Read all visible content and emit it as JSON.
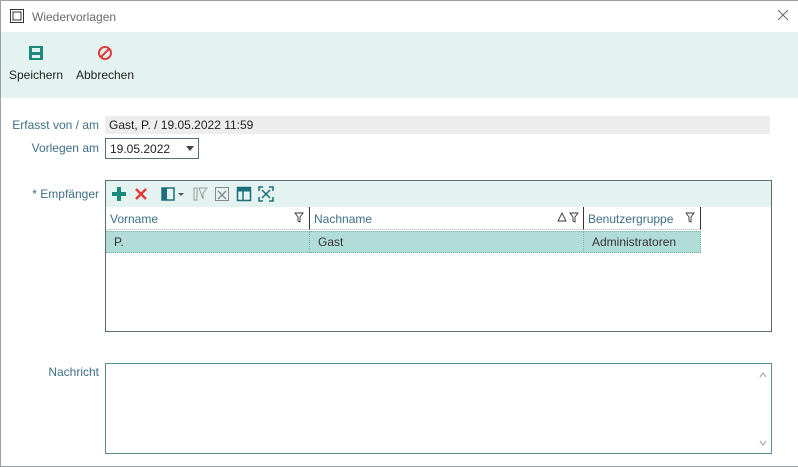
{
  "window": {
    "title": "Wiedervorlagen"
  },
  "toolbar": {
    "save_label": "Speichern",
    "cancel_label": "Abbrechen",
    "accent": "#1a8a7a",
    "cancel_color": "#e23b3b"
  },
  "form": {
    "erfasst_label": "Erfasst von / am",
    "erfasst_value": "Gast, P. / 19.05.2022 11:59",
    "vorlegen_label": "Vorlegen am",
    "vorlegen_value": "19.05.2022",
    "empfaenger_label": "* Empfänger",
    "nachricht_label": "Nachricht",
    "nachricht_value": ""
  },
  "grid": {
    "toolbar_icons": [
      "plus-icon",
      "delete-icon",
      "column-chooser-icon",
      "clear-filter-icon",
      "clear-sort-icon",
      "layout-icon",
      "fit-columns-icon"
    ],
    "columns": [
      {
        "label": "Vorname",
        "filter": true,
        "sort": ""
      },
      {
        "label": "Nachname",
        "filter": true,
        "sort": "ascending"
      },
      {
        "label": "Benutzergruppe",
        "filter": true,
        "sort": ""
      }
    ],
    "rows": [
      [
        "P.",
        "Gast",
        "Administratoren"
      ]
    ]
  }
}
